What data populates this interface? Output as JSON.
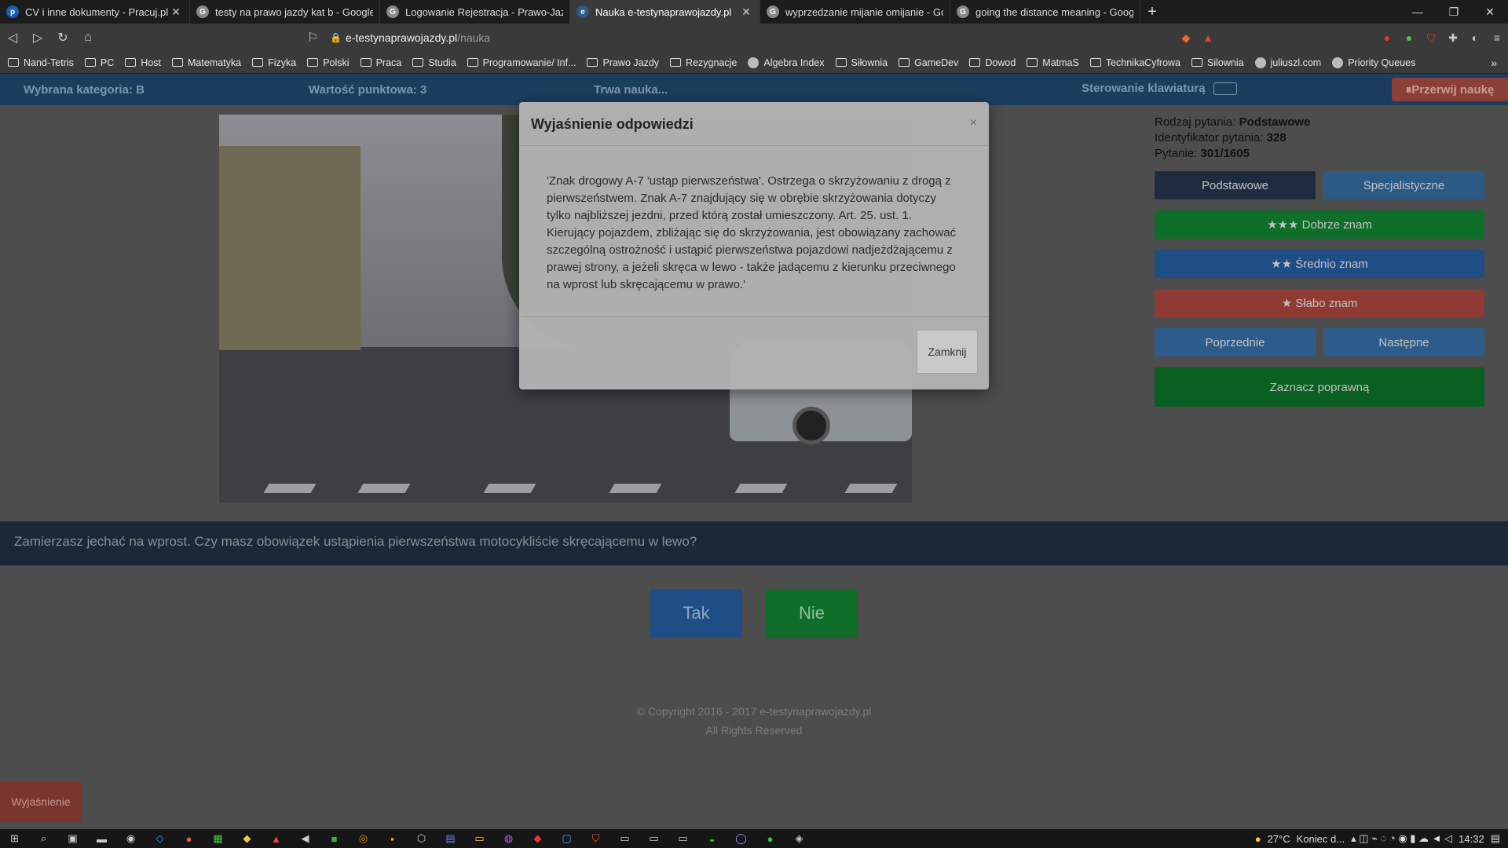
{
  "browser": {
    "tabs": [
      {
        "label": "CV i inne dokumenty - Pracuj.pl",
        "icon": "p"
      },
      {
        "label": "testy na prawo jazdy kat b - Google Sc",
        "icon": "G"
      },
      {
        "label": "Logowanie Rejestracja - Prawo-Jazdy-",
        "icon": "G"
      },
      {
        "label": "Nauka e-testynaprawojazdy.pl",
        "icon": "e"
      },
      {
        "label": "wyprzedzanie mijanie omijanie - Goog",
        "icon": "G"
      },
      {
        "label": "going the distance meaning - Google",
        "icon": "G"
      }
    ],
    "new_tab": "+",
    "window_controls": [
      "—",
      "❐",
      "✕"
    ],
    "url_domain": "e-testynaprawojazdy.pl",
    "url_path": "/nauka",
    "bookmarks": [
      "Nand-Tetris",
      "PC",
      "Host",
      "Matematyka",
      "Fizyka",
      "Polski",
      "Praca",
      "Studia",
      "Programowanie/ Inf...",
      "Prawo Jazdy",
      "Rezygnacje",
      "Algebra Index",
      "Siłownia",
      "GameDev",
      "Dowod",
      "MatmaS",
      "TechnikaCyfrowa",
      "Silownia",
      "juliuszl.com",
      "Priority Queues"
    ],
    "bookmarks_more": "»"
  },
  "topnav": {
    "category": "Wybrana kategoria: B",
    "points": "Wartość punktowa: 3",
    "status": "Trwa nauka...",
    "keyboard": "Sterowanie klawiaturą",
    "pause": "⏸Przerwij naukę"
  },
  "info": {
    "type_label": "Rodzaj pytania:",
    "type_value": "Podstawowe",
    "id_label": "Identyfikator pytania:",
    "id_value": "328",
    "q_label": "Pytanie:",
    "q_value": "301/1605"
  },
  "buttons": {
    "basic": "Podstawowe",
    "special": "Specjalistyczne",
    "good": "★★★ Dobrze znam",
    "medium": "★★ Średnio znam",
    "weak": "★ Słabo znam",
    "prev": "Poprzednie",
    "next": "Następne",
    "mark": "Zaznacz poprawną"
  },
  "colors": {
    "basic": "#1f2c3f",
    "special": "#2b5a86",
    "good": "#0e6e2a",
    "medium": "#1f4d86",
    "weak": "#8f3b33",
    "nav": "#2e5c8a",
    "mark": "#0a5f22"
  },
  "question": "Zamierzasz jechać na wprost. Czy masz obowiązek ustąpienia pierwszeństwa motocykliście skręcającemu w lewo?",
  "answers": {
    "yes": "Tak",
    "no": "Nie"
  },
  "footer": {
    "copyright": "© Copyright 2016 - 2017 e-testynaprawojazdy.pl",
    "rights": "All Rights Reserved"
  },
  "explain_button": "Wyjaśnienie",
  "modal": {
    "title": "Wyjaśnienie odpowiedzi",
    "close_x": "×",
    "body": "'Znak drogowy A-7 'ustąp pierwszeństwa'. Ostrzega o skrzyżowaniu z drogą z pierwszeństwem. Znak A-7 znajdujący się w obrębie skrzyżowania dotyczy tylko najbliższej jezdni, przed którą został umieszczony. Art. 25. ust. 1. Kierujący pojazdem, zbliżając się do skrzyżowania, jest obowiązany zachować szczególną ostrożność i ustąpić pierwszeństwa pojazdowi nadjeżdżającemu z prawej strony, a jeżeli skręca w lewo - także jadącemu z kierunku przeciwnego na wprost lub skręcającemu w prawo.'",
    "close": "Zamknij"
  },
  "taskbar": {
    "temp": "27°C",
    "weather": "Koniec d...",
    "time": "14:32"
  }
}
